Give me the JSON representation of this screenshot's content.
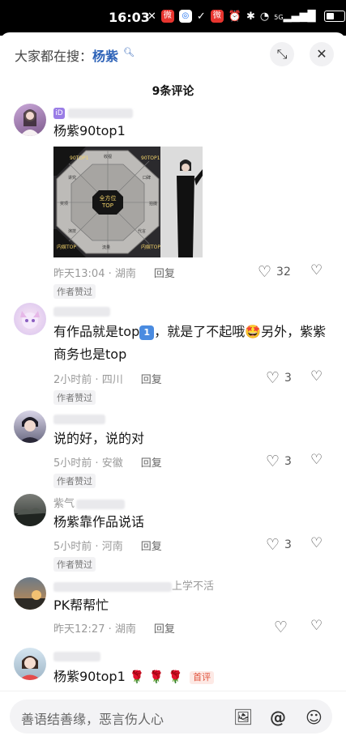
{
  "status_bar": {
    "time": "16:03",
    "icons": [
      "silent-icon",
      "weibo-app-icon",
      "cloud-app-icon",
      "link-icon",
      "weibo-app-icon",
      "alarm-icon",
      "bluetooth-icon",
      "wifi-icon",
      "5g-signal-icon",
      "battery-icon"
    ],
    "network": "5G"
  },
  "header": {
    "search_prefix": "大家都在搜：",
    "search_keyword": "杨紫"
  },
  "comments_title": "9条评论",
  "comments": [
    {
      "badge": "iD",
      "text": "杨紫90top1",
      "image_labels": {
        "center": "全方位\nTOP",
        "segments": [
          "90TOP1",
          "收视",
          "口碑",
          "拍摄",
          "代言",
          "流量",
          "内娱TOP",
          "演技",
          "奖项",
          "讲究"
        ],
        "corner_top_left": "90TOP1",
        "corner_top_right": "90TOP1",
        "corner_bottom_left": "内娱TOP",
        "corner_bottom_right": "内娱TOP"
      },
      "time": "昨天13:04",
      "location": "湖南",
      "reply": "回复",
      "likes": "32",
      "author_liked": "作者赞过"
    },
    {
      "text_before": "有作品就是top",
      "emoji_one": "1",
      "text_after": "，就是了不起哦",
      "text_after2": "另外，紫紫商务也是top",
      "time": "2小时前",
      "location": "四川",
      "reply": "回复",
      "likes": "3",
      "author_liked": "作者赞过"
    },
    {
      "text": "说的好，说的对",
      "time": "5小时前",
      "location": "安徽",
      "reply": "回复",
      "likes": "3",
      "author_liked": "作者赞过"
    },
    {
      "name_prefix": "紫气",
      "text": "杨紫靠作品说话",
      "time": "5小时前",
      "location": "河南",
      "reply": "回复",
      "likes": "3",
      "author_liked": "作者赞过"
    },
    {
      "name_suffix": "上学不活",
      "text": "PK帮帮忙",
      "time": "昨天12:27",
      "location": "湖南",
      "reply": "回复"
    },
    {
      "text": "杨紫90top1",
      "first_tag": "首评"
    }
  ],
  "bottom_bar": {
    "placeholder": "善语结善缘，恶言伤人心",
    "icons": [
      "image-icon",
      "at-icon",
      "emoji-icon"
    ]
  },
  "colors": {
    "accent_blue": "#2e63b8",
    "first_tag": "#e0533c",
    "rose": "#d94a5a"
  }
}
